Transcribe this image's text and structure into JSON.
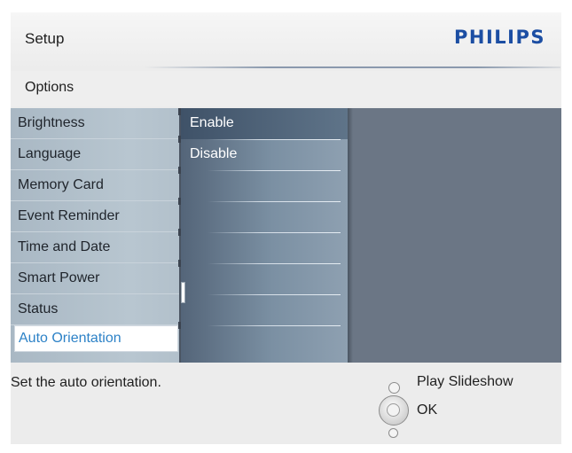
{
  "header": {
    "title": "Setup",
    "brand": "PHILIPS",
    "brand_color": "#1c4ea3"
  },
  "subheader": {
    "title": "Options"
  },
  "menu": {
    "items": [
      {
        "label": "Brightness"
      },
      {
        "label": "Language"
      },
      {
        "label": "Memory Card"
      },
      {
        "label": "Event Reminder"
      },
      {
        "label": "Time and Date"
      },
      {
        "label": "Smart Power"
      },
      {
        "label": "Status"
      },
      {
        "label": "Auto Orientation",
        "selected": true
      }
    ],
    "selected_color": "#2d82c7"
  },
  "options": {
    "items": [
      {
        "label": "Enable",
        "highlighted": true
      },
      {
        "label": "Disable"
      }
    ]
  },
  "footer": {
    "help_text": "Set the auto orientation.",
    "legend": [
      {
        "icon": "circle-button-icon",
        "label": "Play Slideshow"
      },
      {
        "icon": "navigation-pad-icon",
        "label": "OK"
      }
    ]
  }
}
